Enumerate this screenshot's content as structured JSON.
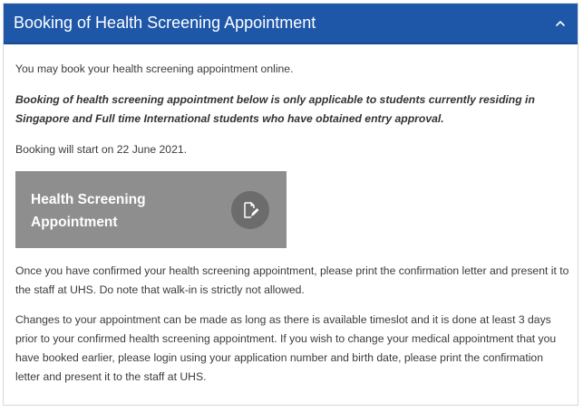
{
  "panel": {
    "title": "Booking of Health Screening Appointment",
    "toggle_icon": "chevron-up-icon"
  },
  "content": {
    "intro": "You may book your health screening appointment online.",
    "eligibility_note": "Booking of health screening appointment below is only applicable to students currently residing in Singapore and Full time International students who have obtained entry approval.",
    "booking_start": "Booking will start on 22 June 2021.",
    "booking_button": {
      "label": "Health Screening Appointment",
      "icon": "edit-document-icon"
    },
    "confirmation_instructions": "Once you have confirmed your health screening appointment, please print the confirmation letter and present it to the staff at UHS. Do note that walk-in is strictly not allowed.",
    "change_instructions": "Changes to your appointment can be made as long as there is available timeslot and it is done at least 3 days prior to your confirmed health screening appointment. If you wish to change your medical appointment that you have booked earlier, please login using your application number and birth date, please print the confirmation letter and present it to the staff at UHS."
  },
  "colors": {
    "header_bg": "#1e56a8",
    "button_bg": "#8e8e8e",
    "button_icon_bg": "#6c6c6c",
    "body_text": "#3b3b3b"
  }
}
